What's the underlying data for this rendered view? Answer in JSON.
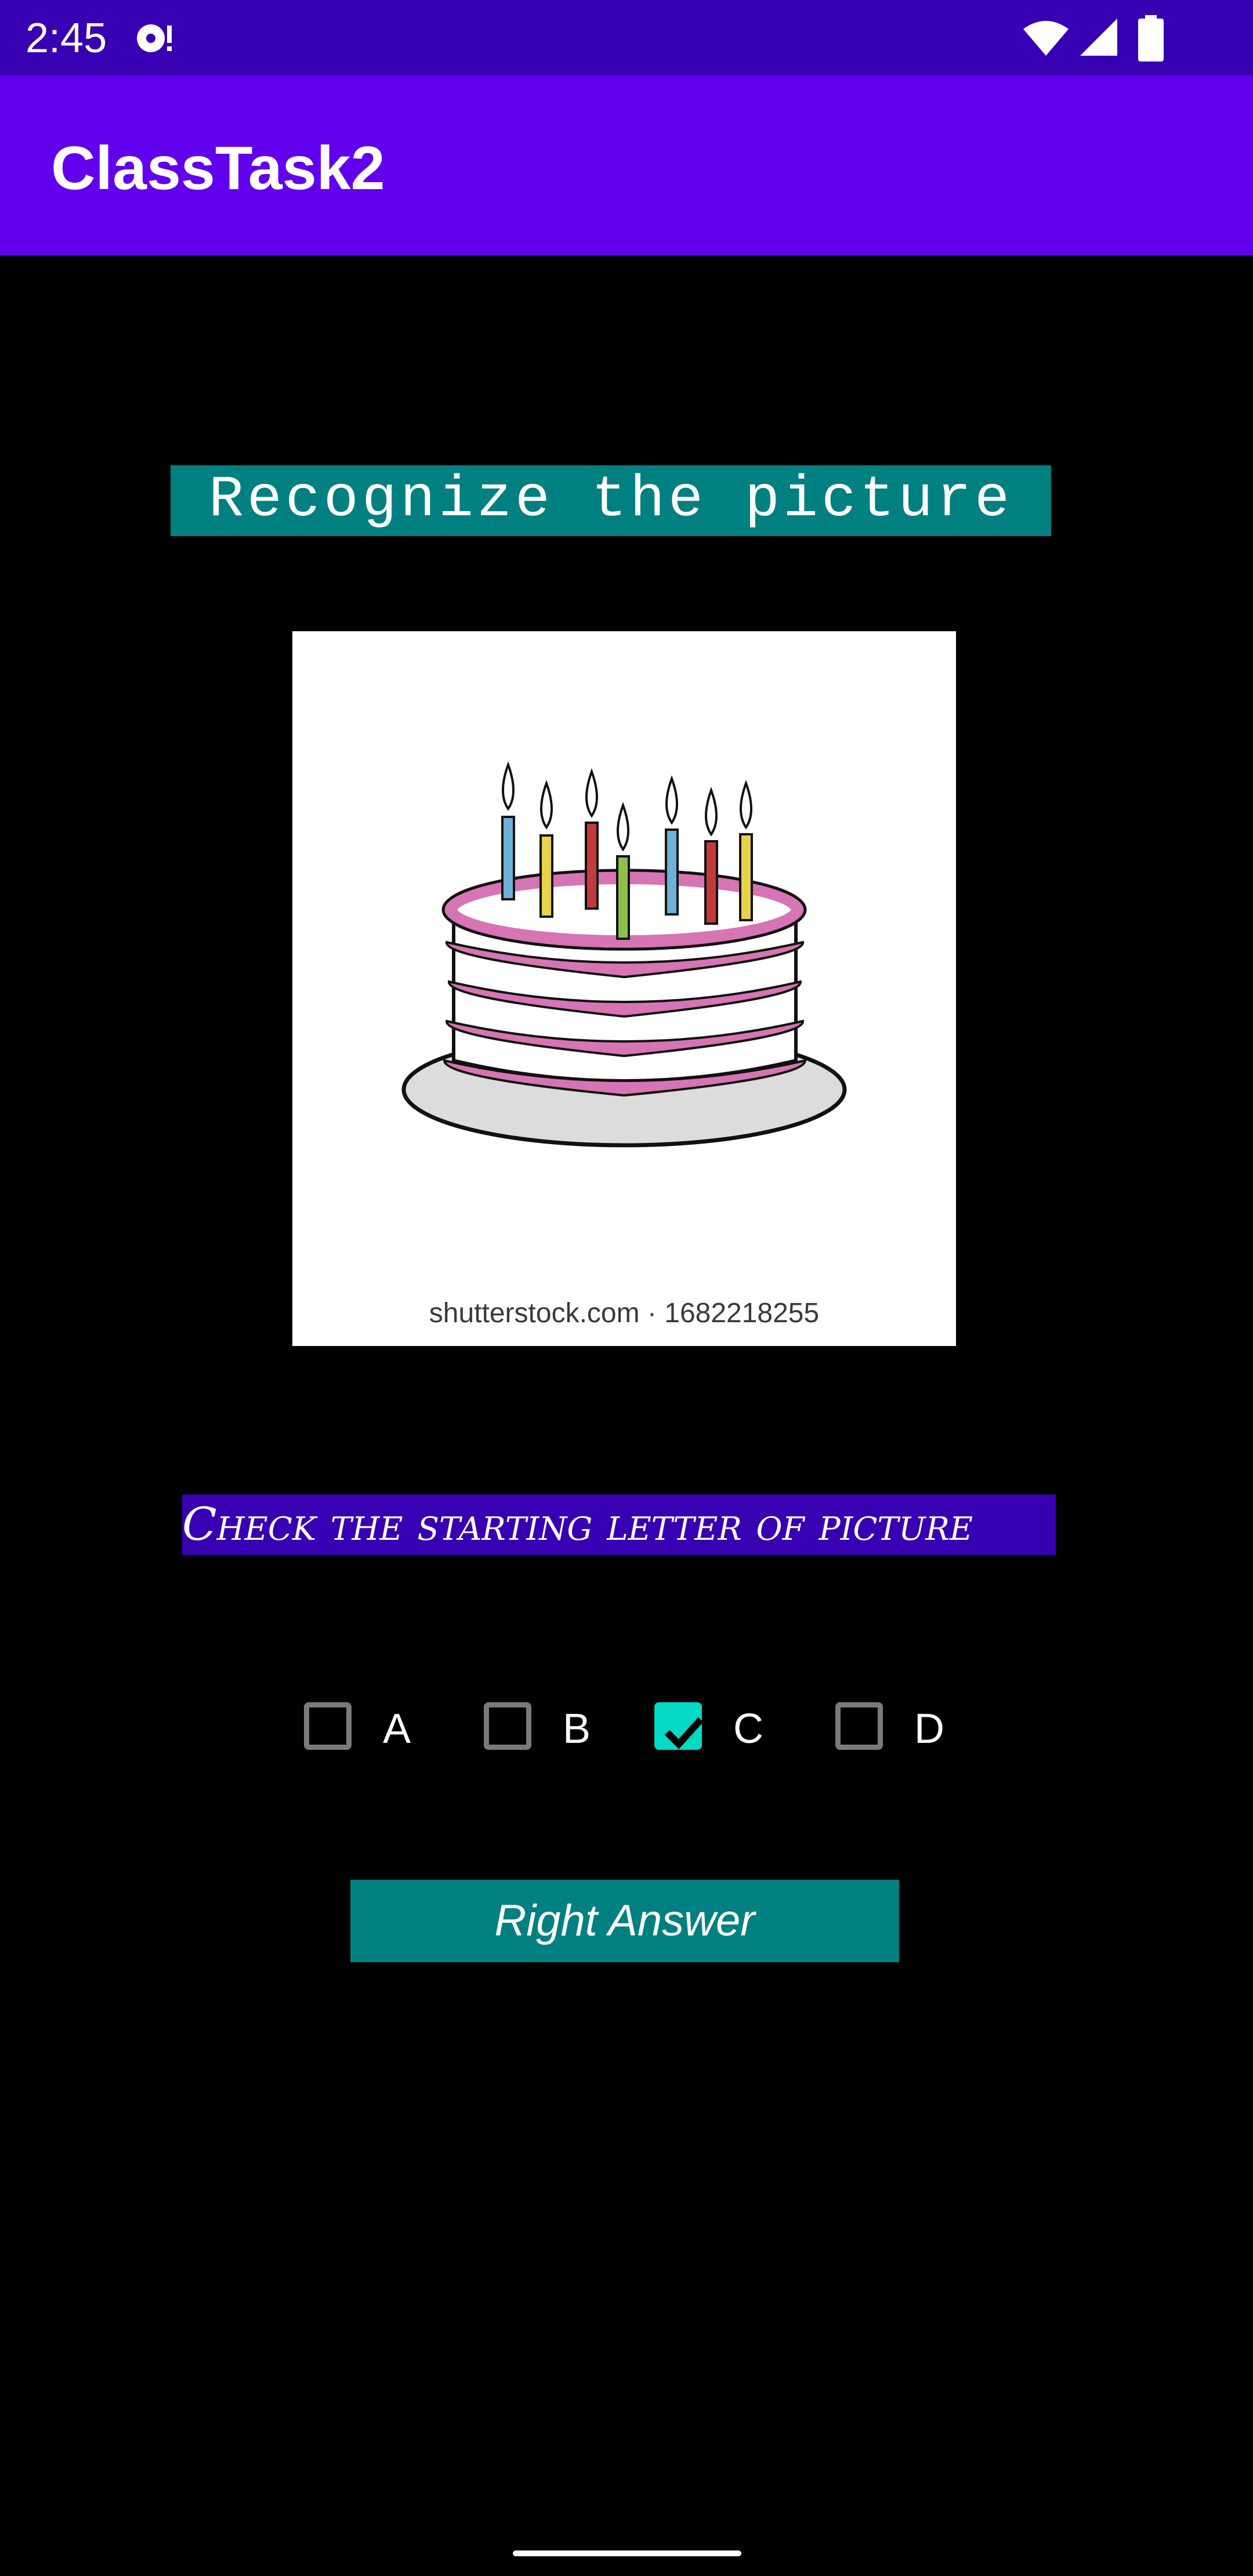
{
  "status_bar": {
    "time": "2:45",
    "icons": [
      "notification-icon",
      "wifi-icon",
      "signal-icon",
      "battery-icon"
    ]
  },
  "app_bar": {
    "title": "ClassTask2",
    "color": "#6200EE"
  },
  "main": {
    "headline": "Recognize the picture",
    "picture": {
      "watermark": "shutterstock.com · 1682218255",
      "subject": "birthday-cake-illustration"
    },
    "instruction": "Check the starting letter of picture",
    "options": [
      {
        "label": "A",
        "checked": false
      },
      {
        "label": "B",
        "checked": false
      },
      {
        "label": "C",
        "checked": true
      },
      {
        "label": "D",
        "checked": false
      }
    ],
    "button_label": "Right Answer"
  },
  "colors": {
    "status_bar": "#3700B3",
    "accent": "#03DAC5",
    "teal": "#008080",
    "background": "#000000"
  }
}
